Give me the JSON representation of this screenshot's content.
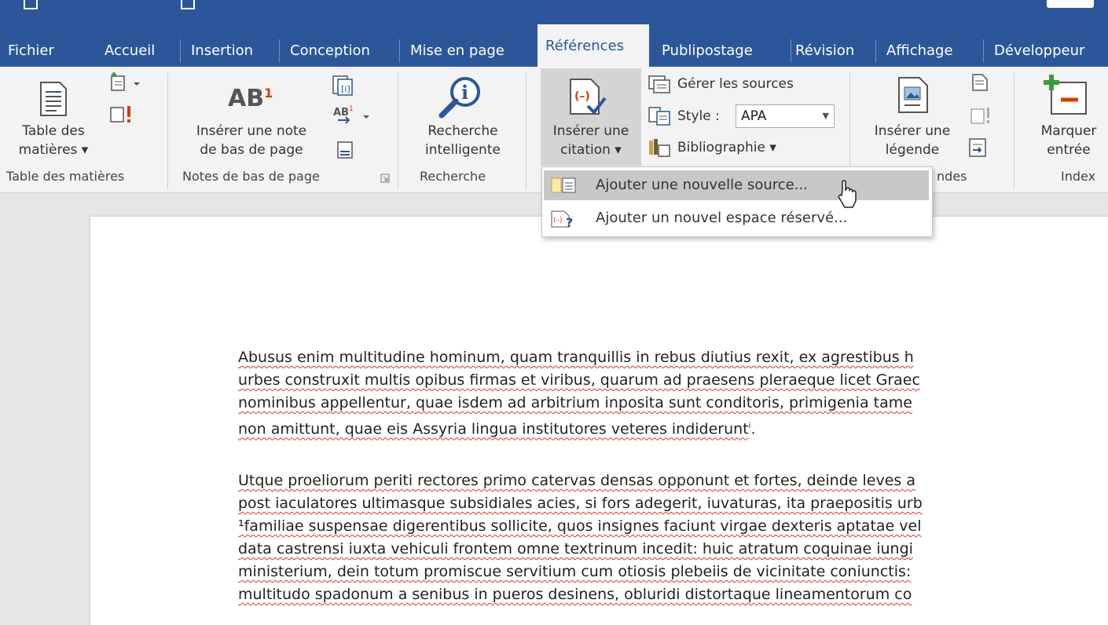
{
  "tabs": [
    "Fichier",
    "Accueil",
    "Insertion",
    "Conception",
    "Mise en page",
    "Références",
    "Publipostage",
    "Révision",
    "Affichage",
    "Développeur"
  ],
  "active_tab": "Références",
  "ribbon": {
    "toc": {
      "label_line1": "Table des",
      "label_line2": "matières ▾",
      "group": "Table des matières"
    },
    "footnotes": {
      "label_line1": "Insérer une note",
      "label_line2": "de bas de page",
      "ab_text": "AB",
      "sup": "1",
      "group": "Notes de bas de page"
    },
    "research": {
      "label_line1": "Recherche",
      "label_line2": "intelligente",
      "group": "Recherche"
    },
    "citations": {
      "insert_line1": "Insérer une",
      "insert_line2": "citation ▾",
      "manage_sources": "Gérer les sources",
      "style_label": "Style :",
      "style_value": "APA",
      "bibliography": "Bibliographie ▾"
    },
    "captions": {
      "label_line1": "Insérer une",
      "label_line2": "légende",
      "group_partial": "ndes"
    },
    "index": {
      "label_line1": "Marquer",
      "label_line2": "entrée",
      "group_partial": "Index"
    }
  },
  "dropdown": {
    "items": [
      {
        "label": "Ajouter une nouvelle source...",
        "highlighted": true
      },
      {
        "label": "Ajouter un nouvel espace réservé...",
        "highlighted": false
      }
    ]
  },
  "document": {
    "paragraph1": [
      "Abusus enim multitudine hominum, quam tranquillis in rebus diutius rexit, ex agrestibus h",
      "urbes construxit multis opibus firmas et viribus, quarum ad praesens pleraeque licet Graec",
      "nominibus appellentur, quae isdem ad arbitrium inposita sunt conditoris, primigenia tame",
      "non amittunt, quae eis Assyria lingua institutores veteres indiderunt"
    ],
    "endnote_mark": "i",
    "paragraph2": [
      "Utque proeliorum periti rectores primo catervas densas opponunt et fortes, deinde leves a",
      "post iaculatores ultimasque subsidiales acies, si fors adegerit, iuvaturas, ita praepositis urb",
      "¹familiae suspensae digerentibus sollicite, quos insignes faciunt virgae dexteris aptatae vel",
      "data castrensi iuxta vehiculi frontem omne textrinum incedit: huic atratum coquinae iungi",
      "ministerium, dein totum promiscue servitium cum otiosis plebeiis de vicinitate coniunctis:",
      "multitudo spadonum a senibus in pueros desinens, obluridi distortaque lineamentorum co"
    ]
  },
  "colors": {
    "ribbon_blue": "#2b579a",
    "ribbon_bg": "#f3f3f3",
    "accent_red": "#d83b01",
    "spell_red": "#d33"
  }
}
